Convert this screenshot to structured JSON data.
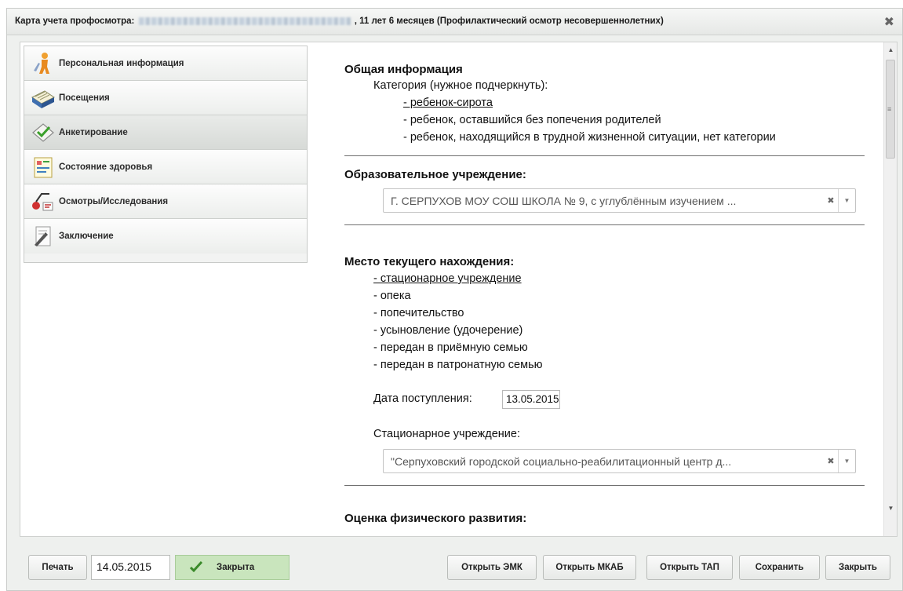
{
  "window": {
    "title_prefix": "Карта учета профосмотра:",
    "title_suffix": ", 11 лет 6 месяцев (Профилактический осмотр несовершеннолетних)",
    "close_icon": "close-icon"
  },
  "sidebar": {
    "items": [
      {
        "label": "Персональная информация",
        "icon": "person-icon"
      },
      {
        "label": "Посещения",
        "icon": "calendar-icon"
      },
      {
        "label": "Анкетирование",
        "icon": "checkmark-envelope-icon"
      },
      {
        "label": "Состояние здоровья",
        "icon": "chart-document-icon"
      },
      {
        "label": "Осмотры/Исследования",
        "icon": "stethoscope-icon"
      },
      {
        "label": "Заключение",
        "icon": "document-pen-icon"
      }
    ],
    "active_index": 2
  },
  "general": {
    "heading": "Общая информация",
    "category_label": "Категория (нужное подчеркнуть):",
    "categories": [
      "- ребенок-сирота",
      "- ребенок, оставшийся без попечения родителей",
      "- ребенок, находящийся в трудной жизненной ситуации, нет категории"
    ]
  },
  "education": {
    "heading": "Образовательное учреждение:",
    "value": "Г. СЕРПУХОВ МОУ СОШ ШКОЛА № 9, с углублённым изучением ..."
  },
  "location": {
    "heading": "Место текущего нахождения:",
    "options": [
      "- стационарное учреждение",
      "- опека",
      "- попечительство",
      "- усыновление (удочерение)",
      "- передан в приёмную семью",
      "- передан в патронатную семью"
    ],
    "admission_date_label": "Дата поступления:",
    "admission_date_value": "13.05.2015",
    "institution_label": "Стационарное учреждение:",
    "institution_value": "\"Серпуховский городской социально-реабилитационный центр д..."
  },
  "physical": {
    "heading": "Оценка физического развития:"
  },
  "footer": {
    "print_label": "Печать",
    "date_value": "14.05.2015",
    "status_label": "Закрыта",
    "open_emk_label": "Открыть ЭМК",
    "open_mkab_label": "Открыть МКАБ",
    "open_tap_label": "Открыть ТАП",
    "save_label": "Сохранить",
    "close_label": "Закрыть"
  }
}
